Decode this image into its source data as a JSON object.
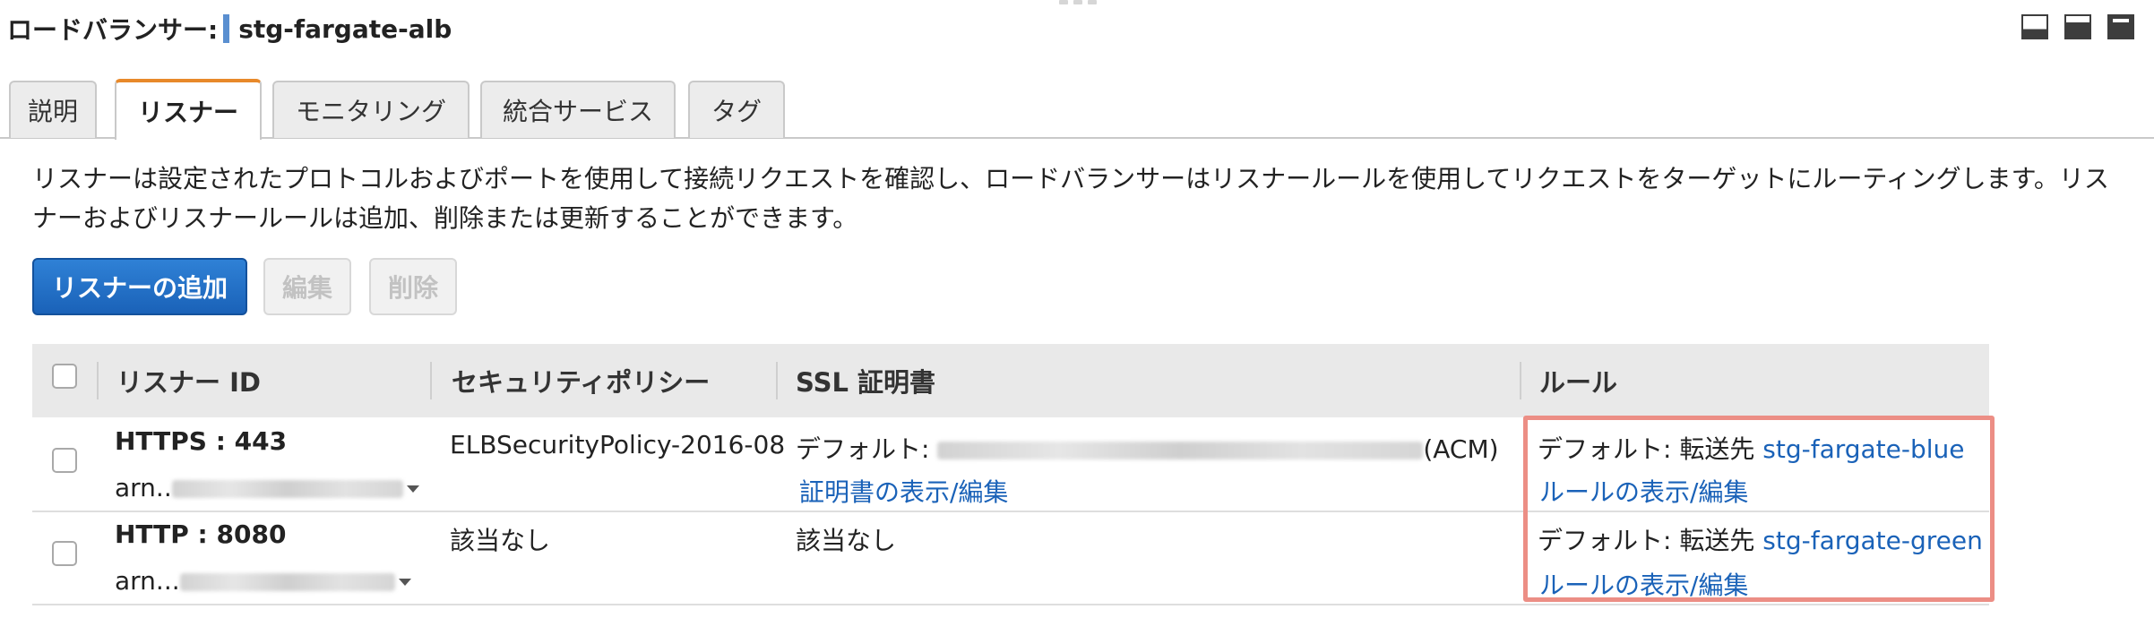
{
  "header": {
    "label": "ロードバランサー:",
    "name": "stg-fargate-alb"
  },
  "tabs": [
    {
      "label": "説明",
      "active": false
    },
    {
      "label": "リスナー",
      "active": true
    },
    {
      "label": "モニタリング",
      "active": false
    },
    {
      "label": "統合サービス",
      "active": false
    },
    {
      "label": "タグ",
      "active": false
    }
  ],
  "description": "リスナーは設定されたプロトコルおよびポートを使用して接続リクエストを確認し、ロードバランサーはリスナールールを使用してリクエストをターゲットにルーティングします。リスナーおよびリスナールールは追加、削除または更新することができます。",
  "buttons": {
    "add": "リスナーの追加",
    "edit": "編集",
    "delete": "削除"
  },
  "table": {
    "headers": [
      "リスナー ID",
      "セキュリティポリシー",
      "SSL 証明書",
      "ルール"
    ],
    "rows": [
      {
        "listener": "HTTPS : 443",
        "arn_prefix": "arn..",
        "policy": "ELBSecurityPolicy-2016-08",
        "ssl_prefix": "デフォルト:",
        "ssl_suffix": "(ACM)",
        "ssl_link": "証明書の表示/編集",
        "rule_prefix": "デフォルト:",
        "rule_action": "転送先",
        "rule_target": "stg-fargate-blue",
        "rule_link": "ルールの表示/編集"
      },
      {
        "listener": "HTTP : 8080",
        "arn_prefix": "arn...",
        "policy": "該当なし",
        "ssl_text": "該当なし",
        "rule_prefix": "デフォルト:",
        "rule_action": "転送先",
        "rule_target": "stg-fargate-green",
        "rule_link": "ルールの表示/編集"
      }
    ]
  },
  "colors": {
    "accent_tab": "#e8892a",
    "primary_button": "#1a62b8",
    "link": "#1a62b8",
    "highlight_box": "#ec8e85"
  }
}
